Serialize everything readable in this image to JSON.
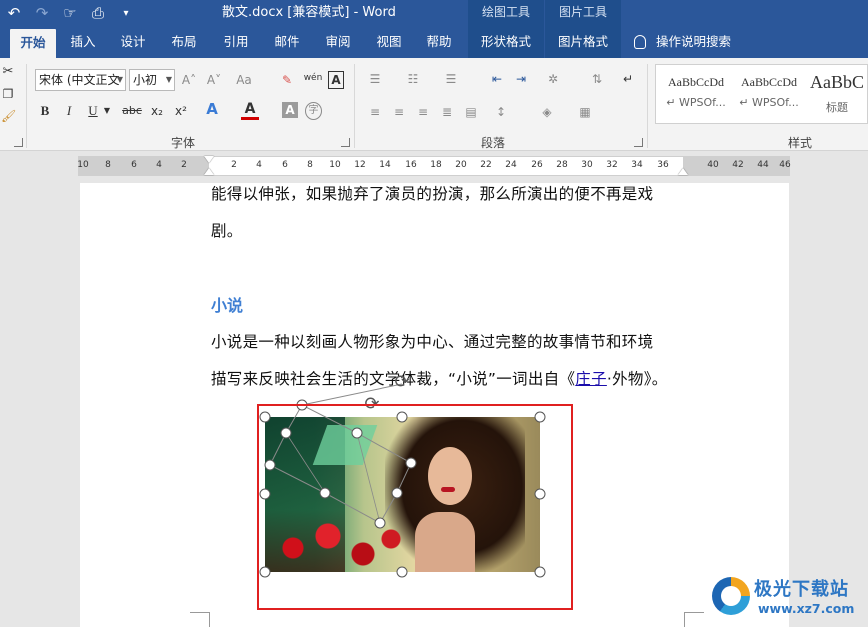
{
  "titlebar": {
    "title": "散文.docx [兼容模式] - Word",
    "qat": {
      "undo": "↶",
      "redo": "↷",
      "touch_mode": "☞",
      "print_preview": "⎙",
      "customize": "▾"
    },
    "context_groups": [
      "绘图工具",
      "图片工具"
    ]
  },
  "tabs": {
    "items": [
      "开始",
      "插入",
      "设计",
      "布局",
      "引用",
      "邮件",
      "审阅",
      "视图",
      "帮助"
    ],
    "context_tabs": [
      "形状格式",
      "图片格式"
    ],
    "tell_me": "操作说明搜索",
    "active": "开始"
  },
  "ribbon": {
    "font_name": "宋体 (中文正文",
    "font_size": "小初",
    "group_font": "字体",
    "group_paragraph": "段落",
    "group_styles": "样式",
    "styles": [
      {
        "preview": "AaBbCcDd",
        "name": "↵ WPSOf..."
      },
      {
        "preview": "AaBbCcDd",
        "name": "↵ WPSOf..."
      },
      {
        "preview": "AaBbC",
        "name": "标题"
      }
    ],
    "font_buttons": {
      "grow": "A˄",
      "shrink": "A˅",
      "change_case": "Aa",
      "clear": "✎",
      "phonetic": "wén",
      "border": "A",
      "bold": "B",
      "italic": "I",
      "underline": "U",
      "strike": "abc",
      "subscript": "x₂",
      "superscript": "x²",
      "effects": "A",
      "color": "A",
      "highlight": "A",
      "enclose": "字"
    }
  },
  "ruler": {
    "ticks": [
      "10",
      "8",
      "6",
      "4",
      "2",
      "2",
      "4",
      "6",
      "8",
      "10",
      "12",
      "14",
      "16",
      "18",
      "20",
      "22",
      "24",
      "26",
      "28",
      "30",
      "32",
      "34",
      "36",
      "40",
      "42",
      "44",
      "46"
    ]
  },
  "document": {
    "line1": "能得以伸张，如果抛弃了演员的扮演，那么所演出的便不再是戏",
    "line2": "剧。",
    "heading": "小说",
    "line3": "小说是一种以刻画人物形象为中心、通过完整的故事情节和环境",
    "line4_prefix": "描写来反映社会生活的文学体裁，“小说”一词出自《",
    "line4_link": "庄子",
    "line4_suffix": "·外物》。"
  },
  "watermark": {
    "name": "极光下载站",
    "url": "www.xz7.com"
  },
  "colors": {
    "brand": "#2b579a",
    "context_tab": "#1f4e8c",
    "heading": "#3f7fd3",
    "highlight_box": "#e02020"
  }
}
